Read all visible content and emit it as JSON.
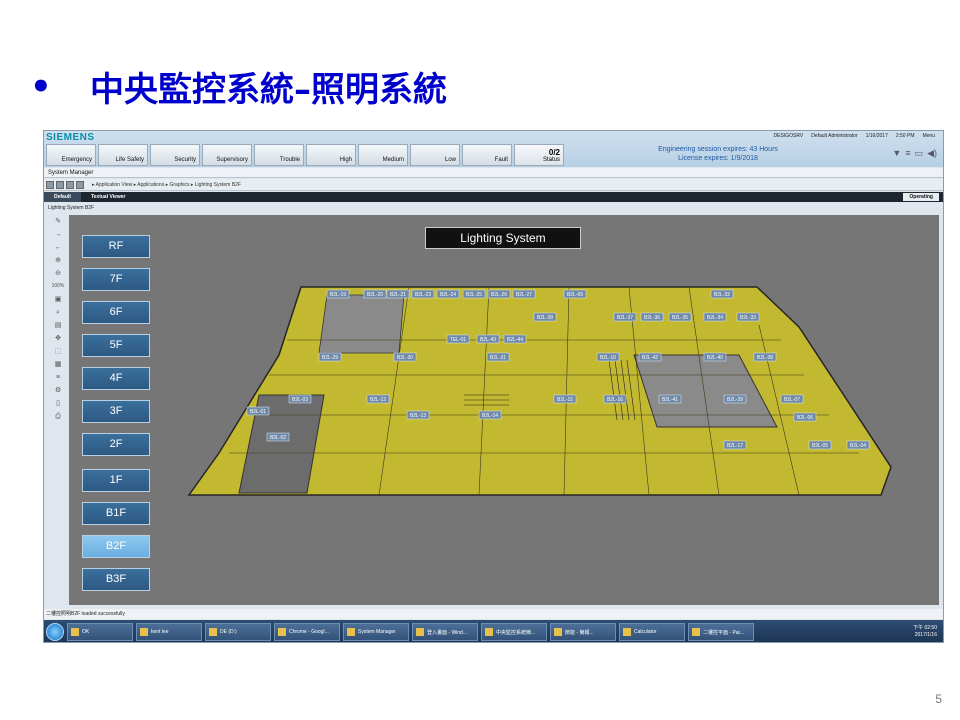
{
  "slide": {
    "bullet": "•",
    "title": "中央監控系統–照明系統",
    "page_number": "5"
  },
  "app": {
    "brand": "SIEMENS",
    "categories": [
      "Emergency",
      "Life Safety",
      "Security",
      "Supervisory",
      "Trouble",
      "High",
      "Medium",
      "Low",
      "Fault"
    ],
    "status": {
      "count": "0/2",
      "label": "Status"
    },
    "engineering": "Engineering session expires: 43 Hours",
    "license": "License expires: 1/9/2018",
    "user": {
      "server": "DESIGOSRV",
      "name": "Default Administrator",
      "date": "1/16/2017",
      "time": "2:50 PM",
      "menu": "Menu"
    },
    "window_title": "System Manager",
    "breadcrumb": "▸ Application View ▸ Applications ▸ Graphics ▸ Lighting System B2F",
    "tabs": [
      "Default",
      "Textual Viewer"
    ],
    "mode": "Operating",
    "view_label": "Lighting System B2F",
    "zoom": "100%",
    "graphic_title": "Lighting System",
    "floors": [
      "RF",
      "7F",
      "6F",
      "5F",
      "4F",
      "3F",
      "2F",
      "1F",
      "B1F",
      "B2F",
      "B3F"
    ],
    "active_floor": "B2F",
    "zone_labels": [
      "B2L-19",
      "B2L-20",
      "B2L-21",
      "B2L-23",
      "B2L-24",
      "B2L-25",
      "B2L-26",
      "B2L-27",
      "B2L-09",
      "B2L-32",
      "B2L-28",
      "B2L-37",
      "B2L-36",
      "B2L-35",
      "B2L-34",
      "B2L-33",
      "TEL-01",
      "B2L-43",
      "B2L-44",
      "B2L-29",
      "B2L-30",
      "B2L-31",
      "B2L-10",
      "B2L-42",
      "B2L-40",
      "B2L-38",
      "B2L-03",
      "B2L-12",
      "B2L-15",
      "B2L-16",
      "B2L-41",
      "B2L-39",
      "B2L-07",
      "B2L-01",
      "B2L-13",
      "B2L-14",
      "B2L-06",
      "B2L-02",
      "B2L-17",
      "B2L-05",
      "B2L-04"
    ],
    "statusbar": "二樓控照明B2F loaded successfully",
    "taskbar": [
      "OK",
      "kent lee",
      "DE (D:)",
      "Chrome - Googl...",
      "System Manager",
      "登入畫面 - Wind...",
      "中央監控系統簡...",
      "節能 - 簡報...",
      "Calculator",
      "二樓控平面 - Pai..."
    ],
    "clock": {
      "time": "下午 02:50",
      "date": "2017/1/16"
    }
  },
  "colors": {
    "title": "#0000cc",
    "zone_fill": "#c8bd2e",
    "canvas_bg": "#767676",
    "floor_button": "#2d5a83",
    "floor_active": "#6aaee0"
  }
}
